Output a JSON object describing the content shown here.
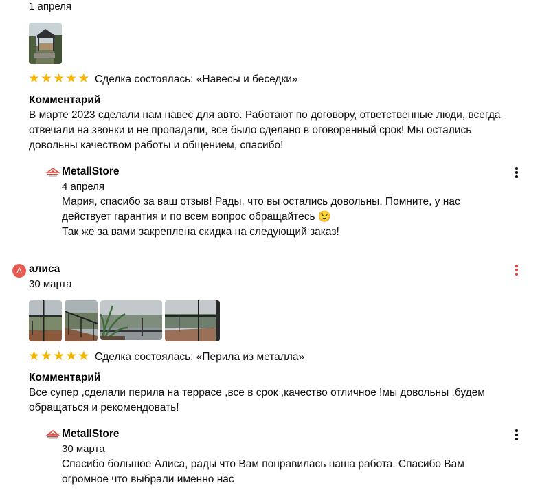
{
  "review1": {
    "date": "1 апреля",
    "rating": 5,
    "deal": "Сделка состоялась: «Навесы и беседки»",
    "comment_heading": "Комментарий",
    "comment_lines": [
      "В марте 2023 сделали нам навес для авто. Работают по договору, ответственные люди, всегда",
      "отвечали на звонки и не пропадали, все было сделано в оговоренный срок! Мы остались",
      "довольны качеством работы и общением, спасибо!"
    ],
    "reply": {
      "company": "MetallStore",
      "date": "4 апреля",
      "lines": [
        "Мария, спасибо за ваш отзыв! Рады, что вы остались довольны. Помните, у нас",
        "действует гарантия и по всем вопрос обращайтесь",
        "Так же за вами закреплена скидка на следующий заказ!"
      ],
      "emoji": "😉"
    }
  },
  "review2": {
    "author_initial": "А",
    "author": "алиса",
    "date": "30 марта",
    "rating": 5,
    "deal": "Сделка состоялась: «Перила из металла»",
    "comment_heading": "Комментарий",
    "comment_lines": [
      "Все супер ,сделали перила на террасе ,все в срок ,качество отличное !мы довольны ,будем",
      "обращаться и рекомендовать!"
    ],
    "reply": {
      "company": "MetallStore",
      "date": "30 марта",
      "lines": [
        "Спасибо большое Алиса, рады что Вам понравилась наша работа. Спасибо Вам",
        "огромное что выбрали именно нас"
      ]
    }
  },
  "colors": {
    "star": "#f5b400",
    "avatar": "#e85a52",
    "kebab_active": "#e04545"
  },
  "icons": {
    "star": "star-icon",
    "menu": "more-vertical-icon",
    "logo": "metallstore-logo-icon"
  }
}
